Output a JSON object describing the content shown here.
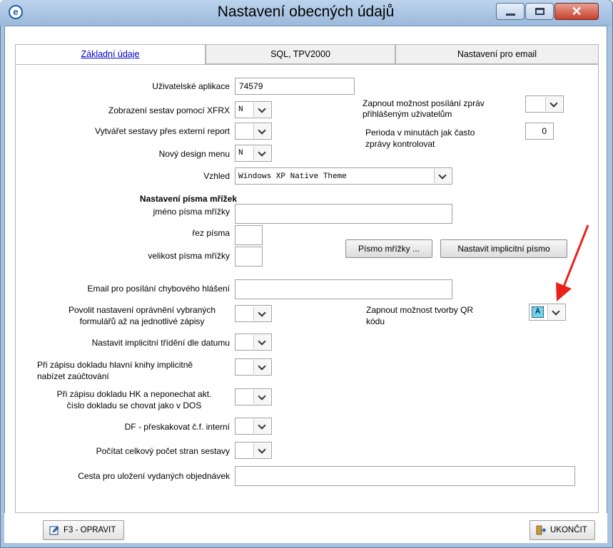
{
  "window": {
    "title": "Nastavení obecných údajů",
    "app_icon_letter": "e",
    "close_glyph": "✕"
  },
  "tabs": [
    {
      "label": "Základní údaje",
      "active": true
    },
    {
      "label": "SQL, TPV2000",
      "active": false
    },
    {
      "label": "Nastavení pro email",
      "active": false
    }
  ],
  "form": {
    "user_apps_label": "Uživatelské aplikace",
    "user_apps_value": "74579",
    "xfrx_label": "Zobrazení sestav pomocí XFRX",
    "xfrx_value": "N",
    "external_report_label": "Vytvářet sestavy přes externí report",
    "external_report_value": "",
    "new_menu_label": "Nový design menu",
    "new_menu_value": "N",
    "theme_label": "Vzhled",
    "theme_value": "Windows XP Native Theme",
    "messages_label_1": "Zapnout možnost posílání zpráv",
    "messages_label_2": "přihlášeným uživatelům",
    "messages_value": "",
    "period_label_1": "Perioda v minutách jak často",
    "period_label_2": "zprávy kontrolovat",
    "period_value": "0",
    "grid_font_heading": "Nastavení písma mřížek",
    "grid_font_name_label": "jméno písma mřížky",
    "grid_font_name_value": "",
    "font_style_label": "řez písma",
    "font_style_value": "",
    "grid_font_size_label": "velikost písma mřížky",
    "grid_font_size_value": "",
    "grid_font_button": "Písmo mřížky ...",
    "default_font_button": "Nastavit implicitní písmo",
    "error_email_label": "Email pro posílání chybového hlášení",
    "error_email_value": "",
    "permissions_label_1": "Povolit nastavení oprávnění vybraných",
    "permissions_label_2": "formulářů až na jednotlivé zápisy",
    "permissions_value": "",
    "qr_label_1": "Zapnout možnost tvorby QR",
    "qr_label_2": "kódu",
    "qr_value": "A",
    "date_sort_label": "Nastavit implicitní třídění dle datumu",
    "date_sort_value": "",
    "ledger_label_1": "Při zápisu dokladu hlavní knihy implicitně",
    "ledger_label_2": "nabízet zaúčtování",
    "ledger_value": "",
    "hk_label_1": "Při zápisu dokladu HK a neponechat akt.",
    "hk_label_2": "číslo dokladu se chovat jako v DOS",
    "hk_value": "",
    "df_label": "DF - přeskakovat č.f. interní",
    "df_value": "",
    "page_count_label": "Počítat celkový počet stran sestavy",
    "page_count_value": "",
    "orders_path_label": "Cesta pro uložení vydaných objednávek",
    "orders_path_value": ""
  },
  "footer": {
    "edit_button": "F3 - OPRAVIT",
    "exit_button": "UKONČIT"
  },
  "colors": {
    "frame": "#a9c3df",
    "close_button": "#c9402c",
    "qr_highlight": "#6fd3f3",
    "annotation_arrow": "#e8221b",
    "active_tab_link": "#0000cc"
  }
}
